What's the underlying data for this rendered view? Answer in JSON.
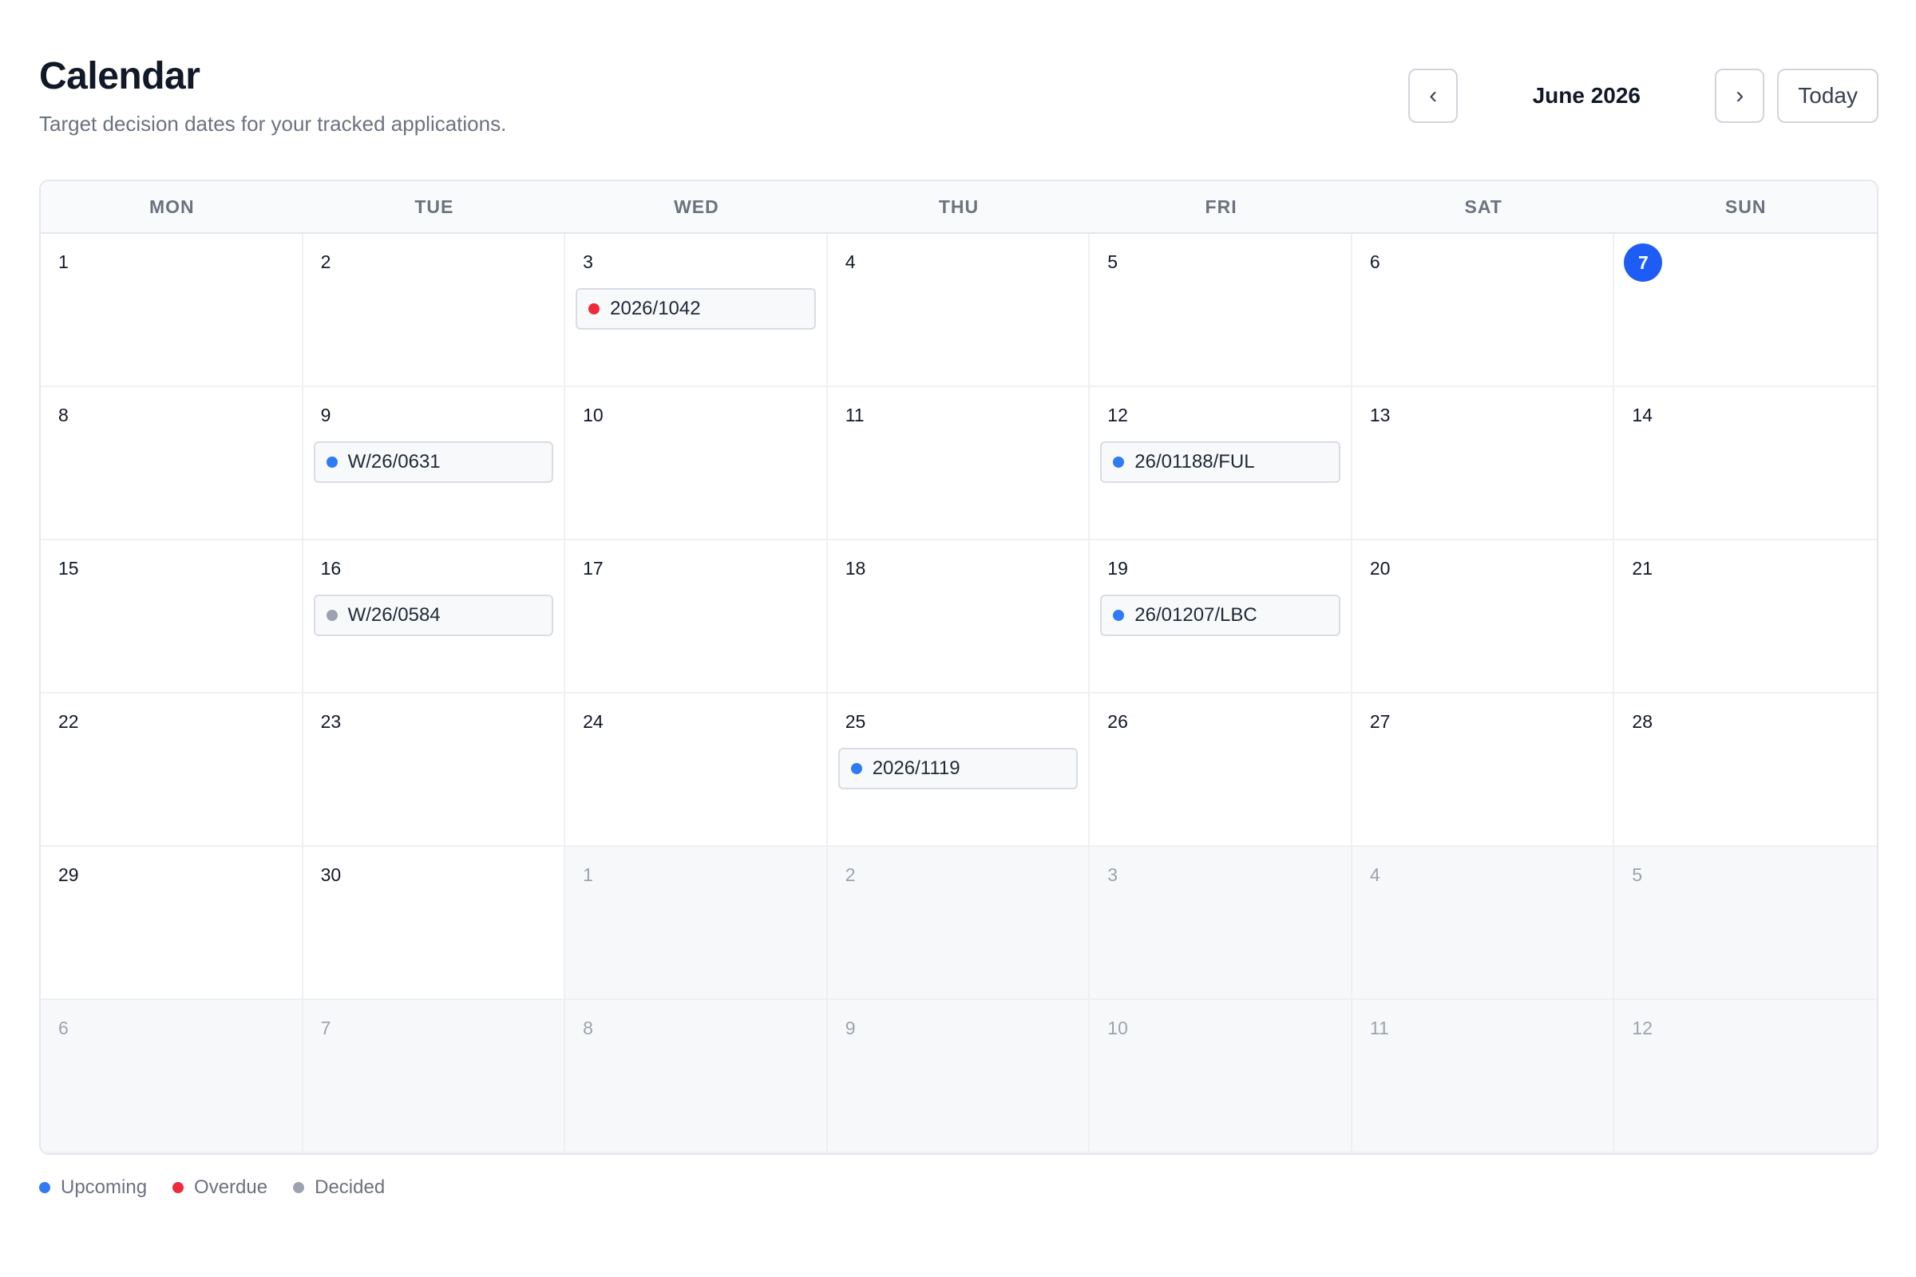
{
  "header": {
    "title": "Calendar",
    "subtitle": "Target decision dates for your tracked applications."
  },
  "nav": {
    "prev_label": "‹",
    "month_label": "June 2026",
    "next_label": "›",
    "today_label": "Today"
  },
  "colors": {
    "upcoming": "#2f7bf5",
    "overdue": "#ef2b3a",
    "decided": "#9ca3af",
    "today_accent": "#1d5cf5"
  },
  "calendar": {
    "weekdays": [
      "MON",
      "TUE",
      "WED",
      "THU",
      "FRI",
      "SAT",
      "SUN"
    ],
    "days": [
      {
        "label": "1"
      },
      {
        "label": "2"
      },
      {
        "label": "3",
        "event": {
          "ref": "2026/1042",
          "status": "overdue"
        }
      },
      {
        "label": "4"
      },
      {
        "label": "5"
      },
      {
        "label": "6"
      },
      {
        "label": "7",
        "today": true
      },
      {
        "label": "8"
      },
      {
        "label": "9",
        "event": {
          "ref": "W/26/0631",
          "status": "upcoming"
        }
      },
      {
        "label": "10"
      },
      {
        "label": "11"
      },
      {
        "label": "12",
        "event": {
          "ref": "26/01188/FUL",
          "status": "upcoming"
        }
      },
      {
        "label": "13"
      },
      {
        "label": "14"
      },
      {
        "label": "15"
      },
      {
        "label": "16",
        "event": {
          "ref": "W/26/0584",
          "status": "decided"
        }
      },
      {
        "label": "17"
      },
      {
        "label": "18"
      },
      {
        "label": "19",
        "event": {
          "ref": "26/01207/LBC",
          "status": "upcoming"
        }
      },
      {
        "label": "20"
      },
      {
        "label": "21"
      },
      {
        "label": "22"
      },
      {
        "label": "23"
      },
      {
        "label": "24"
      },
      {
        "label": "25",
        "event": {
          "ref": "2026/1119",
          "status": "upcoming"
        }
      },
      {
        "label": "26"
      },
      {
        "label": "27"
      },
      {
        "label": "28"
      },
      {
        "label": "29"
      },
      {
        "label": "30"
      },
      {
        "label": "1",
        "outside": true
      },
      {
        "label": "2",
        "outside": true
      },
      {
        "label": "3",
        "outside": true
      },
      {
        "label": "4",
        "outside": true
      },
      {
        "label": "5",
        "outside": true
      },
      {
        "label": "6",
        "outside": true
      },
      {
        "label": "7",
        "outside": true
      },
      {
        "label": "8",
        "outside": true
      },
      {
        "label": "9",
        "outside": true
      },
      {
        "label": "10",
        "outside": true
      },
      {
        "label": "11",
        "outside": true
      },
      {
        "label": "12",
        "outside": true
      }
    ]
  },
  "legend": [
    {
      "label": "Upcoming",
      "status": "upcoming"
    },
    {
      "label": "Overdue",
      "status": "overdue"
    },
    {
      "label": "Decided",
      "status": "decided"
    }
  ]
}
